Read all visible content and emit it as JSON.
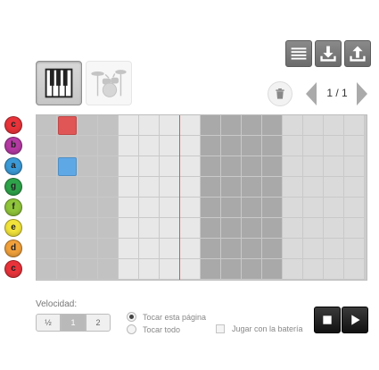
{
  "toolbar": {
    "menu_icon": "menu-lines-icon",
    "download_icon": "download-icon",
    "upload_icon": "upload-icon"
  },
  "instruments": [
    {
      "name": "piano",
      "icon": "piano-keys-icon",
      "active": true
    },
    {
      "name": "drums",
      "icon": "drum-kit-icon",
      "active": false
    }
  ],
  "pager": {
    "count": "1 / 1"
  },
  "notes": [
    {
      "label": "c",
      "color": "#e8333a"
    },
    {
      "label": "b",
      "color": "#b43aa3"
    },
    {
      "label": "a",
      "color": "#3b9ad6"
    },
    {
      "label": "g",
      "color": "#2ea34a"
    },
    {
      "label": "f",
      "color": "#8fc43a"
    },
    {
      "label": "e",
      "color": "#f0e23a"
    },
    {
      "label": "d",
      "color": "#f0a03a"
    },
    {
      "label": "c",
      "color": "#e8333a"
    }
  ],
  "grid": {
    "columns": 16,
    "rows": 8,
    "playhead_column": 7,
    "active_cells": [
      {
        "row": 0,
        "col": 1,
        "color": "#e05555"
      },
      {
        "row": 2,
        "col": 1,
        "color": "#5fa8e6"
      }
    ]
  },
  "controls": {
    "velocity_label": "Velocidad:",
    "velocity_options": [
      "½",
      "1",
      "2"
    ],
    "velocity_selected": "1",
    "play_options": [
      {
        "label": "Tocar esta página",
        "selected": true
      },
      {
        "label": "Tocar todo",
        "selected": false
      }
    ],
    "drums_checkbox_label": "Jugar con la batería",
    "drums_checked": false
  }
}
